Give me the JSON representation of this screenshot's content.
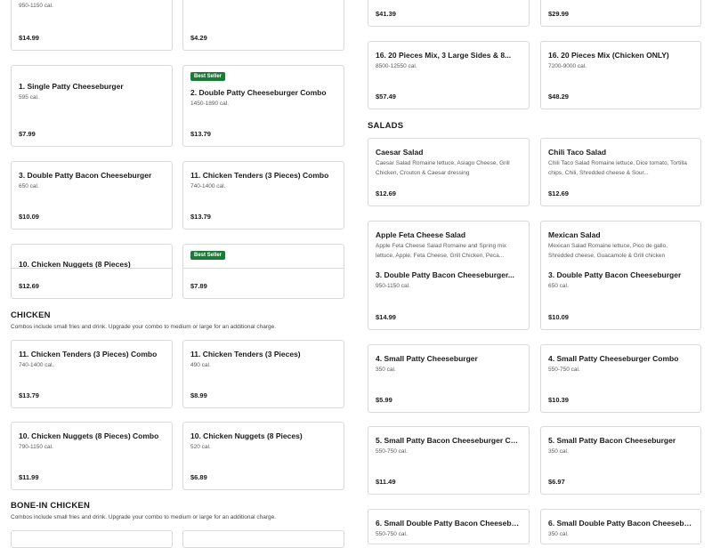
{
  "left": {
    "top_cards": [
      {
        "cal": "950-1150 cal.",
        "price": "$14.99"
      },
      {
        "cal": "",
        "price": "$4.29"
      }
    ],
    "row2": [
      {
        "name": "1. Single Patty Cheeseburger",
        "cal": "595 cal.",
        "price": "$7.99"
      },
      {
        "badge": "Best Seller",
        "name": "2. Double Patty Cheeseburger Combo",
        "cal": "1450-1890 cal.",
        "price": "$13.79"
      }
    ],
    "row3": [
      {
        "name": "3. Double Patty Bacon Cheeseburger",
        "cal": "650 cal.",
        "price": "$10.09"
      },
      {
        "name": "11. Chicken Tenders (3 Pieces) Combo",
        "cal": "740-1400 cal.",
        "price": "$13.79"
      }
    ],
    "row4": [
      {
        "name": "10. Chicken Nuggets (8 Pieces)",
        "price": "$12.69"
      },
      {
        "badge": "Best Seller",
        "price": "$7.89"
      }
    ],
    "chicken": {
      "title": "CHICKEN",
      "subtitle": "Combos include small fries and drink. Upgrade your combo to medium or large for an additional charge.",
      "items": [
        {
          "name": "11. Chicken Tenders (3 Pieces) Combo",
          "cal": "740-1400 cal.",
          "price": "$13.79"
        },
        {
          "name": "11. Chicken Tenders (3 Pieces)",
          "cal": "490 cal.",
          "price": "$8.99"
        },
        {
          "name": "10. Chicken Nuggets (8 Pieces) Combo",
          "cal": "790-1150 cal.",
          "price": "$11.99"
        },
        {
          "name": "10. Chicken Nuggets (8 Pieces)",
          "cal": "520 cal.",
          "price": "$6.89"
        }
      ]
    },
    "bonein": {
      "title": "BONE-IN CHICKEN",
      "subtitle": "Combos include small fries and drink. Upgrade your combo to medium or large for an additional charge."
    }
  },
  "right": {
    "top_cards": [
      {
        "price": "$41.39"
      },
      {
        "price": "$29.99"
      }
    ],
    "row2": [
      {
        "name": "16. 20 Pieces Mix, 3 Large Sides & 8...",
        "cal": "8500-12550 cal.",
        "price": "$57.49"
      },
      {
        "name": "16. 20 Pieces Mix (Chicken ONLY)",
        "cal": "7200-9000 cal.",
        "price": "$48.29"
      }
    ],
    "salads": {
      "title": "SALADS",
      "items": [
        {
          "name": "Caesar Salad",
          "desc": "Caesar Salad Romaine lettuce, Asiago Cheese, Grill Chicken, Crouton & Caesar dressing",
          "price": "$12.69"
        },
        {
          "name": "Chili Taco Salad",
          "desc": "Chili Taco Salad Romaine lettuce, Dice tomato, Tortilla chips, Chili, Shredded cheese & Sour...",
          "price": "$12.69"
        },
        {
          "name": "Apple Feta Cheese Salad",
          "desc": "Apple Feta Cheese Salad Romaine and Spring mix lettuce, Apple, Feta Cheese, Grill Chicken, Peca..."
        },
        {
          "name": "Mexican Salad",
          "desc": "Mexican Salad Romaine lettuce, Pico de gallo, Shredded cheese, Guacamole & Grill chicken"
        }
      ]
    },
    "burgers": [
      {
        "name": "3. Double Patty Bacon Cheeseburger...",
        "cal": "950-1150 cal.",
        "price": "$14.99"
      },
      {
        "name": "3. Double Patty Bacon Cheeseburger",
        "cal": "650 cal.",
        "price": "$10.09"
      },
      {
        "name": "4. Small Patty Cheeseburger",
        "cal": "350 cal.",
        "price": "$5.99"
      },
      {
        "name": "4. Small Patty Cheeseburger Combo",
        "cal": "550-750 cal.",
        "price": "$10.39"
      },
      {
        "name": "5. Small Patty Bacon Cheeseburger Combo",
        "cal": "550-750 cal.",
        "price": "$11.49"
      },
      {
        "name": "5. Small Patty Bacon Cheeseburger",
        "cal": "350 cal.",
        "price": "$6.97"
      },
      {
        "name": "6. Small Double Patty Bacon Cheeseburg...",
        "cal": "550-750 cal."
      },
      {
        "name": "6. Small Double Patty Bacon Cheeseburger",
        "cal": "350 cal."
      }
    ]
  },
  "colors": {
    "badge": "#1f7a3a",
    "border": "#d9d9d9"
  }
}
